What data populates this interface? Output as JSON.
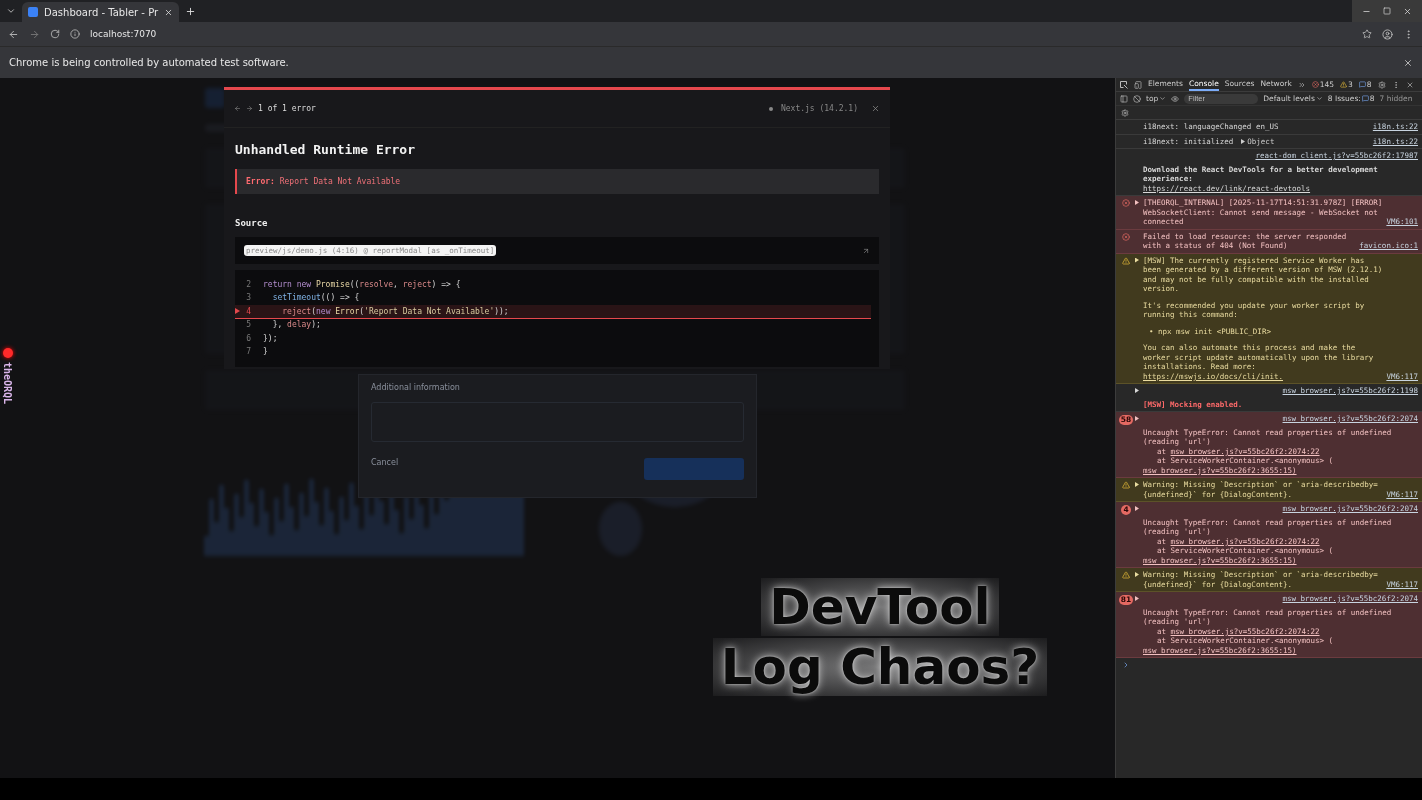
{
  "browser": {
    "tabs": [
      {
        "title": "Dashboard - Tabler - Pr",
        "selected": true
      }
    ],
    "url": "localhost:7070",
    "infobar": "Chrome is being controlled by automated test software."
  },
  "page": {
    "dialog": {
      "field_label": "Additional information",
      "cancel": "Cancel"
    },
    "side_badge": "theORQL",
    "overlay_title": [
      "DevTool",
      "Log Chaos?"
    ]
  },
  "error_overlay": {
    "pager": "1 of 1 error",
    "framework": "Next.js (14.2.1)",
    "title": "Unhandled Runtime Error",
    "error_label": "Error:",
    "error_message": "Report Data Not Available",
    "section": "Source",
    "file": "preview/js/demo.js (4:16) @ reportModal [as _onTimeout]",
    "code": [
      {
        "number": "2",
        "highlighted": false,
        "tokens": [
          {
            "kind": "keyword",
            "text": "return new "
          },
          {
            "kind": "class",
            "text": "Promise"
          },
          {
            "kind": "plain",
            "text": "(("
          },
          {
            "kind": "param",
            "text": "resolve"
          },
          {
            "kind": "plain",
            "text": ", "
          },
          {
            "kind": "param",
            "text": "reject"
          },
          {
            "kind": "plain",
            "text": ") => {"
          }
        ]
      },
      {
        "number": "3",
        "highlighted": false,
        "tokens": [
          {
            "kind": "function",
            "text": "  setTimeout"
          },
          {
            "kind": "plain",
            "text": "(() => {"
          }
        ]
      },
      {
        "number": "4",
        "highlighted": true,
        "tokens": [
          {
            "kind": "param",
            "text": "    reject"
          },
          {
            "kind": "plain",
            "text": "("
          },
          {
            "kind": "keyword",
            "text": "new "
          },
          {
            "kind": "class",
            "text": "Error"
          },
          {
            "kind": "plain",
            "text": "("
          },
          {
            "kind": "string",
            "text": "'Report Data Not Available'"
          },
          {
            "kind": "plain",
            "text": "));"
          }
        ]
      },
      {
        "number": "5",
        "highlighted": false,
        "tokens": [
          {
            "kind": "plain",
            "text": "  }, "
          },
          {
            "kind": "param",
            "text": "delay"
          },
          {
            "kind": "plain",
            "text": ");"
          }
        ]
      },
      {
        "number": "6",
        "highlighted": false,
        "tokens": [
          {
            "kind": "plain",
            "text": "});"
          }
        ]
      },
      {
        "number": "7",
        "highlighted": false,
        "tokens": [
          {
            "kind": "plain",
            "text": "}"
          }
        ]
      }
    ]
  },
  "devtools": {
    "tabs": [
      {
        "label": "Elements",
        "selected": false
      },
      {
        "label": "Console",
        "selected": true
      },
      {
        "label": "Sources",
        "selected": false
      },
      {
        "label": "Network",
        "selected": false
      }
    ],
    "errors": "145",
    "warnings": "3",
    "infos": "8",
    "context": "top",
    "filter": {
      "placeholder": "Filter"
    },
    "levels": "Default levels",
    "issues": "8 Issues:",
    "issue_count": "8",
    "hidden": "7 hidden",
    "messages": [
      {
        "kind": "log",
        "expandable": false,
        "source": "i18n.ts:22",
        "lines": [
          {
            "kind": "text",
            "text": "i18next: languageChanged en_US"
          }
        ]
      },
      {
        "kind": "log",
        "expandable": false,
        "source": "i18n.ts:22",
        "lines": [
          {
            "kind": "text",
            "text": "i18next: initialized"
          },
          {
            "kind": "object",
            "text": "Object"
          }
        ]
      },
      {
        "kind": "log",
        "expandable": false,
        "source": "react-dom_client.js?v=55bc26f2:17987",
        "lines": [
          {
            "kind": "bold",
            "text": "Download the React DevTools for a better development experience:"
          },
          {
            "kind": "link",
            "text": "https://react.dev/link/react-devtools"
          }
        ]
      },
      {
        "kind": "error",
        "expandable": true,
        "source": "VM6:101",
        "lines": [
          {
            "kind": "text",
            "text": "[THEORQL_INTERNAL] [2025-11-17T14:51:31.978Z] [ERROR] WebSocketClient: Cannot send message - WebSocket not connected"
          }
        ]
      },
      {
        "kind": "error",
        "expandable": false,
        "source": "favicon.ico:1",
        "lines": [
          {
            "kind": "text",
            "text": "Failed to load resource: the server responded with a status of 404 (Not Found)"
          }
        ]
      },
      {
        "kind": "warning",
        "expandable": true,
        "source": "VM6:117",
        "lines": [
          {
            "kind": "text",
            "text": "[MSW] The currently registered Service Worker has been generated by a different version of MSW (2.12.1) and may not be fully compatible with the installed version."
          },
          {
            "kind": "gap",
            "text": "It's recommended you update your worker script by running this command:"
          },
          {
            "kind": "bullet",
            "text": "• npx msw init <PUBLIC_DIR>"
          },
          {
            "kind": "gap",
            "text": "You can also automate this process and make the worker script update automatically upon the library installations. Read more:"
          },
          {
            "kind": "link",
            "text": "https://mswjs.io/docs/cli/init."
          }
        ]
      },
      {
        "kind": "log",
        "expandable": true,
        "source": "msw_browser.js?v=55bc26f2:1198",
        "lines": [
          {
            "kind": "alert",
            "text": "[MSW] Mocking enabled."
          }
        ]
      },
      {
        "kind": "error",
        "count": "58",
        "expandable": true,
        "source": "msw_browser.js?v=55bc26f2:2074",
        "lines": [
          {
            "kind": "text",
            "text": "Uncaught TypeError: Cannot read properties of undefined (reading 'url')"
          },
          {
            "kind": "stack",
            "prefix": "at",
            "text": "msw_browser.js?v=55bc26f2:2074:22"
          },
          {
            "kind": "stack",
            "text": "at ServiceWorkerContainer.<anonymous> ("
          },
          {
            "kind": "stack-link",
            "text": "msw_browser.js?v=55bc26f2:3655:15)"
          }
        ]
      },
      {
        "kind": "warning",
        "expandable": true,
        "source": "VM6:117",
        "lines": [
          {
            "kind": "text",
            "text": "Warning: Missing `Description` or `aria-describedby={undefined}` for {DialogContent}."
          }
        ]
      },
      {
        "kind": "error",
        "count": "4",
        "expandable": true,
        "source": "msw_browser.js?v=55bc26f2:2074",
        "lines": [
          {
            "kind": "text",
            "text": "Uncaught TypeError: Cannot read properties of undefined (reading 'url')"
          },
          {
            "kind": "stack",
            "prefix": "at",
            "text": "msw_browser.js?v=55bc26f2:2074:22"
          },
          {
            "kind": "stack",
            "text": "at ServiceWorkerContainer.<anonymous> ("
          },
          {
            "kind": "stack-link",
            "text": "msw_browser.js?v=55bc26f2:3655:15)"
          }
        ]
      },
      {
        "kind": "warning",
        "expandable": true,
        "source": "VM6:117",
        "lines": [
          {
            "kind": "text",
            "text": "Warning: Missing `Description` or `aria-describedby={undefined}` for {DialogContent}."
          }
        ]
      },
      {
        "kind": "error",
        "count": "81",
        "expandable": true,
        "source": "msw_browser.js?v=55bc26f2:2074",
        "lines": [
          {
            "kind": "text",
            "text": "Uncaught TypeError: Cannot read properties of undefined (reading 'url')"
          },
          {
            "kind": "stack",
            "prefix": "at",
            "text": "msw_browser.js?v=55bc26f2:2074:22"
          },
          {
            "kind": "stack",
            "text": "at ServiceWorkerContainer.<anonymous> ("
          },
          {
            "kind": "stack-link",
            "text": "msw_browser.js?v=55bc26f2:3655:15)"
          }
        ]
      }
    ]
  }
}
